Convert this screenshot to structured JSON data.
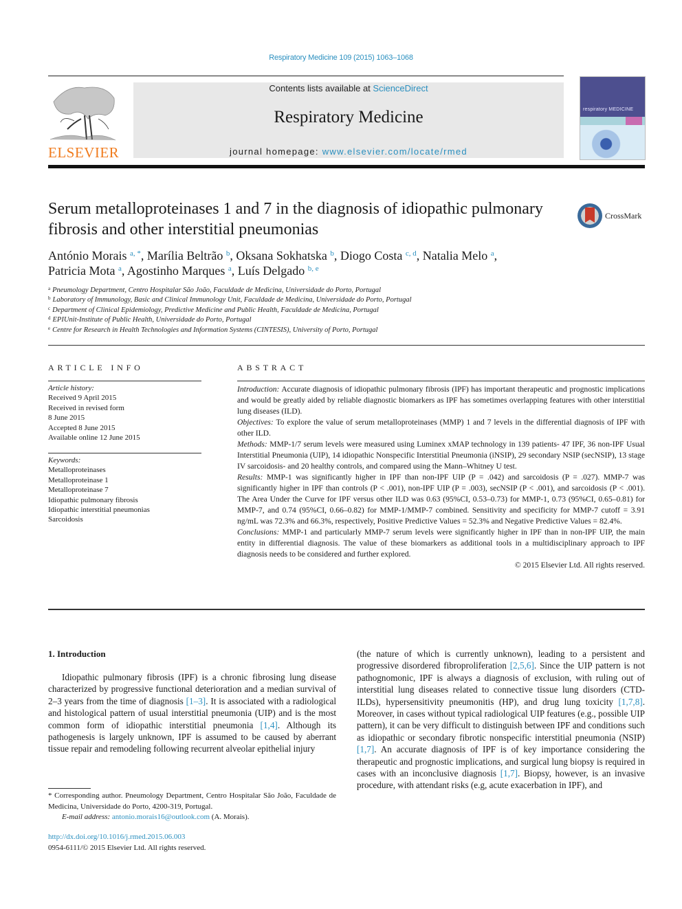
{
  "header": {
    "citation": "Respiratory Medicine 109 (2015) 1063–1068",
    "contents_prefix": "Contents lists available at ",
    "contents_link": "ScienceDirect",
    "journal_name": "Respiratory Medicine",
    "homepage_prefix": "journal homepage: ",
    "homepage_link": "www.elsevier.com/locate/rmed",
    "publisher_logo_text": "ELSEVIER",
    "cover_title": "respiratory MEDICINE",
    "crossmark_label": "CrossMark",
    "brand_color": "#f07b1d",
    "link_color": "#2a8fbf"
  },
  "article": {
    "title": "Serum metalloproteinases 1 and 7 in the diagnosis of idiopathic pulmonary fibrosis and other interstitial pneumonias",
    "authors": [
      {
        "name": "António Morais",
        "sup": "a, *"
      },
      {
        "name": "Marília Beltrão",
        "sup": "b"
      },
      {
        "name": "Oksana Sokhatska",
        "sup": "b"
      },
      {
        "name": "Diogo Costa",
        "sup": "c, d"
      },
      {
        "name": "Natalia Melo",
        "sup": "a"
      },
      {
        "name": "Patricia Mota",
        "sup": "a"
      },
      {
        "name": "Agostinho Marques",
        "sup": "a"
      },
      {
        "name": "Luís Delgado",
        "sup": "b, e"
      }
    ],
    "affiliations": [
      {
        "key": "a",
        "text": "Pneumology Department, Centro Hospitalar São João, Faculdade de Medicina, Universidade do Porto, Portugal"
      },
      {
        "key": "b",
        "text": "Laboratory of Immunology, Basic and Clinical Immunology Unit, Faculdade de Medicina, Universidade do Porto, Portugal"
      },
      {
        "key": "c",
        "text": "Department of Clinical Epidemiology, Predictive Medicine and Public Health, Faculdade de Medicina, Portugal"
      },
      {
        "key": "d",
        "text": "EPIUnit-Institute of Public Health, Universidade do Porto, Portugal"
      },
      {
        "key": "e",
        "text": "Centre for Research in Health Technologies and Information Systems (CINTESIS), University of Porto, Portugal"
      }
    ]
  },
  "article_info": {
    "heading": "ARTICLE INFO",
    "history_label": "Article history:",
    "history": [
      "Received 9 April 2015",
      "Received in revised form",
      "8 June 2015",
      "Accepted 8 June 2015",
      "Available online 12 June 2015"
    ],
    "keywords_label": "Keywords:",
    "keywords": [
      "Metalloproteinases",
      "Metalloproteinase 1",
      "Metalloproteinase 7",
      "Idiopathic pulmonary fibrosis",
      "Idiopathic interstitial pneumonias",
      "Sarcoidosis"
    ]
  },
  "abstract": {
    "heading": "ABSTRACT",
    "sections": [
      {
        "label": "Introduction:",
        "text": "Accurate diagnosis of idiopathic pulmonary fibrosis (IPF) has important therapeutic and prognostic implications and would be greatly aided by reliable diagnostic biomarkers as IPF has sometimes overlapping features with other interstitial lung diseases (ILD)."
      },
      {
        "label": "Objectives:",
        "text": "To explore the value of serum metalloproteinases (MMP) 1 and 7 levels in the differential diagnosis of IPF with other ILD."
      },
      {
        "label": "Methods:",
        "text": "MMP-1/7 serum levels were measured using Luminex xMAP technology in 139 patients- 47 IPF, 36 non-IPF Usual Interstitial Pneumonia (UIP), 14 idiopathic Nonspecific Interstitial Pneumonia (iNSIP), 29 secondary NSIP (secNSIP), 13 stage IV sarcoidosis- and 20 healthy controls, and compared using the Mann–Whitney U test."
      },
      {
        "label": "Results:",
        "text": "MMP-1 was significantly higher in IPF than non-IPF UIP (P = .042) and sarcoidosis (P = .027). MMP-7 was significantly higher in IPF than controls (P < .001), non-IPF UIP (P = .003), secNSIP (P < .001), and sarcoidosis (P < .001). The Area Under the Curve for IPF versus other ILD was 0.63 (95%CI, 0.53–0.73) for MMP-1, 0.73 (95%CI, 0.65–0.81) for MMP-7, and 0.74 (95%CI, 0.66–0.82) for MMP-1/MMP-7 combined. Sensitivity and specificity for MMP-7 cutoff = 3.91 ng/mL was 72.3% and 66.3%, respectively, Positive Predictive Values = 52.3% and Negative Predictive Values = 82.4%."
      },
      {
        "label": "Conclusions:",
        "text": "MMP-1 and particularly MMP-7 serum levels were significantly higher in IPF than in non-IPF UIP, the main entity in differential diagnosis. The value of these biomarkers as additional tools in a multidisciplinary approach to IPF diagnosis needs to be considered and further explored."
      }
    ],
    "copyright": "© 2015 Elsevier Ltd. All rights reserved."
  },
  "body": {
    "section_heading": "1.  Introduction",
    "left_column": [
      {
        "t": "Idiopathic pulmonary fibrosis (IPF) is a chronic fibrosing lung disease characterized by progressive functional deterioration and a median survival of 2–3 years from the time of diagnosis "
      },
      {
        "ref": "[1–3]"
      },
      {
        "t": ". It is associated with a radiological and histological pattern of usual interstitial pneumonia (UIP) and is the most common form of idiopathic interstitial pneumonia "
      },
      {
        "ref": "[1,4]"
      },
      {
        "t": ". Although its pathogenesis is largely unknown, IPF is assumed to be caused by aberrant tissue repair and remodeling following recurrent alveolar epithelial injury"
      }
    ],
    "right_column": [
      {
        "t": "(the nature of which is currently unknown), leading to a persistent and progressive disordered fibroproliferation "
      },
      {
        "ref": "[2,5,6]"
      },
      {
        "t": ". Since the UIP pattern is not pathognomonic, IPF is always a diagnosis of exclusion, with ruling out of interstitial lung diseases related to connective tissue lung disorders (CTD-ILDs), hypersensitivity pneumonitis (HP), and drug lung toxicity "
      },
      {
        "ref": "[1,7,8]"
      },
      {
        "t": ". Moreover, in cases without typical radiological UIP features (e.g., possible UIP pattern), it can be very difficult to distinguish between IPF and conditions such as idiopathic or secondary fibrotic nonspecific interstitial pneumonia (NSIP) "
      },
      {
        "ref": "[1,7]"
      },
      {
        "t": ". An accurate diagnosis of IPF is of key importance considering the therapeutic and prognostic implications, and surgical lung biopsy is required in cases with an inconclusive diagnosis "
      },
      {
        "ref": "[1,7]"
      },
      {
        "t": ". Biopsy, however, is an invasive procedure, with attendant risks (e.g, acute exacerbation in IPF), and"
      }
    ]
  },
  "footnote": {
    "corresponding": "* Corresponding author. Pneumology Department, Centro Hospitalar São João, Faculdade de Medicina, Universidade do Porto, 4200-319, Portugal.",
    "email_label": "E-mail address: ",
    "email": "antonio.morais16@outlook.com",
    "email_suffix": " (A. Morais).",
    "doi": "http://dx.doi.org/10.1016/j.rmed.2015.06.003",
    "issn_line": "0954-6111/© 2015 Elsevier Ltd. All rights reserved."
  }
}
